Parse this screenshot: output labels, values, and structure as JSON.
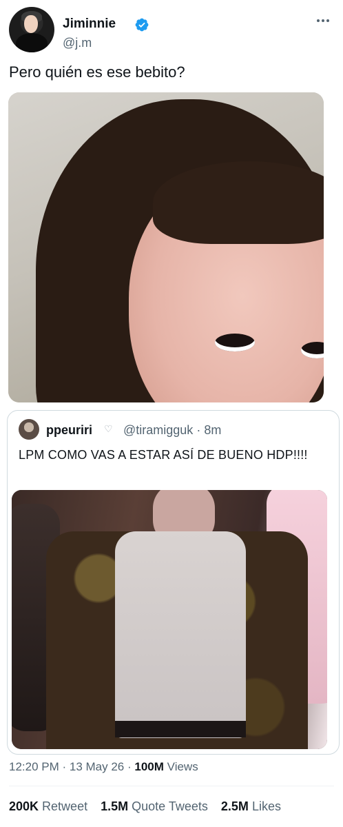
{
  "author": {
    "display_name": "Jiminnie",
    "handle": "@j.m",
    "verified": true
  },
  "tweet": {
    "text": "Pero quién es ese bebito?"
  },
  "quoted_tweet": {
    "display_name": "ppeuriri",
    "name_emoji": "♡",
    "handle": "@tiramigguk",
    "time": "· 8m",
    "text": "LPM COMO VAS A ESTAR ASÍ DE BUENO HDP!!!!"
  },
  "meta": {
    "time": "12:20 PM",
    "date": "· 13 May 26 ·",
    "views_count": "100M",
    "views_label": "Views"
  },
  "stats": {
    "retweets_count": "200K",
    "retweets_label": "Retweet",
    "quotes_count": "1.5M",
    "quotes_label": "Quote Tweets",
    "likes_count": "2.5M",
    "likes_label": "Likes"
  },
  "colors": {
    "verified_blue": "#1d9bf0",
    "secondary_text": "#536471",
    "primary_text": "#0f1419",
    "border": "#cfd9de"
  }
}
